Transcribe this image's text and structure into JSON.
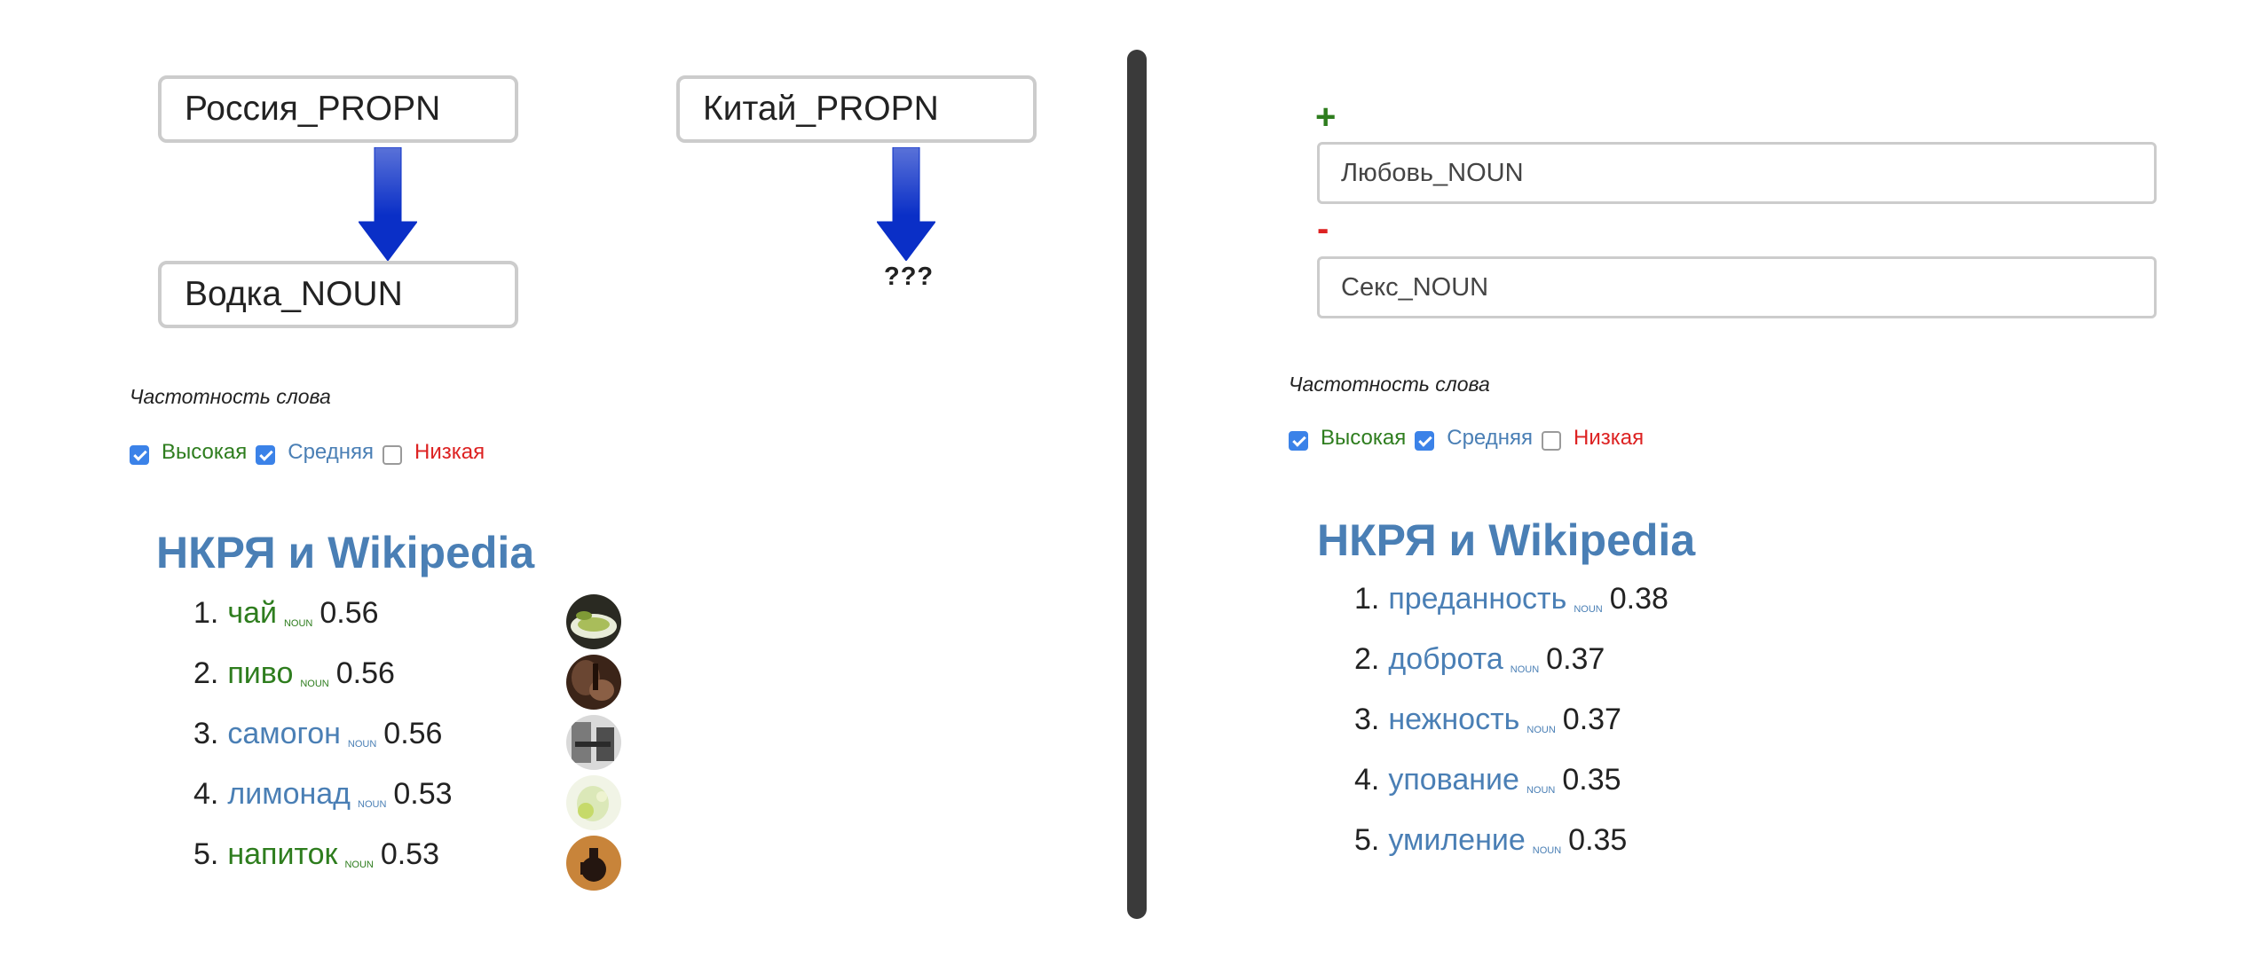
{
  "left": {
    "word_a": "Россия_PROPN",
    "word_b": "Водка_NOUN",
    "word_c": "Китай_PROPN",
    "unknown": "???",
    "freq_title": "Частотность слова",
    "freq": {
      "high": "Высокая",
      "mid": "Средняя",
      "low": "Низкая",
      "high_checked": true,
      "mid_checked": true,
      "low_checked": false
    },
    "heading": "НКРЯ и Wikipedia",
    "results": [
      {
        "n": "1.",
        "word": "чай",
        "pos": "NOUN",
        "score": "0.56",
        "color": "green"
      },
      {
        "n": "2.",
        "word": "пиво",
        "pos": "NOUN",
        "score": "0.56",
        "color": "green"
      },
      {
        "n": "3.",
        "word": "самогон",
        "pos": "NOUN",
        "score": "0.56",
        "color": "blue"
      },
      {
        "n": "4.",
        "word": "лимонад",
        "pos": "NOUN",
        "score": "0.53",
        "color": "blue"
      },
      {
        "n": "5.",
        "word": "напиток",
        "pos": "NOUN",
        "score": "0.53",
        "color": "green"
      }
    ]
  },
  "right": {
    "plus_sign": "+",
    "minus_sign": "-",
    "plus_value": "Любовь_NOUN",
    "minus_value": "Секс_NOUN",
    "freq_title": "Частотность слова",
    "freq": {
      "high": "Высокая",
      "mid": "Средняя",
      "low": "Низкая",
      "high_checked": true,
      "mid_checked": true,
      "low_checked": false
    },
    "heading": "НКРЯ и Wikipedia",
    "results": [
      {
        "n": "1.",
        "word": "преданность",
        "pos": "NOUN",
        "score": "0.38",
        "color": "blue"
      },
      {
        "n": "2.",
        "word": "доброта",
        "pos": "NOUN",
        "score": "0.37",
        "color": "blue"
      },
      {
        "n": "3.",
        "word": "нежность",
        "pos": "NOUN",
        "score": "0.37",
        "color": "blue"
      },
      {
        "n": "4.",
        "word": "упование",
        "pos": "NOUN",
        "score": "0.35",
        "color": "blue"
      },
      {
        "n": "5.",
        "word": "умиление",
        "pos": "NOUN",
        "score": "0.35",
        "color": "blue"
      }
    ]
  },
  "colors": {
    "green": "#2e7d1e",
    "blue": "#4a7fb5",
    "red": "#dd2222",
    "arrow": "#0a2fc7"
  }
}
